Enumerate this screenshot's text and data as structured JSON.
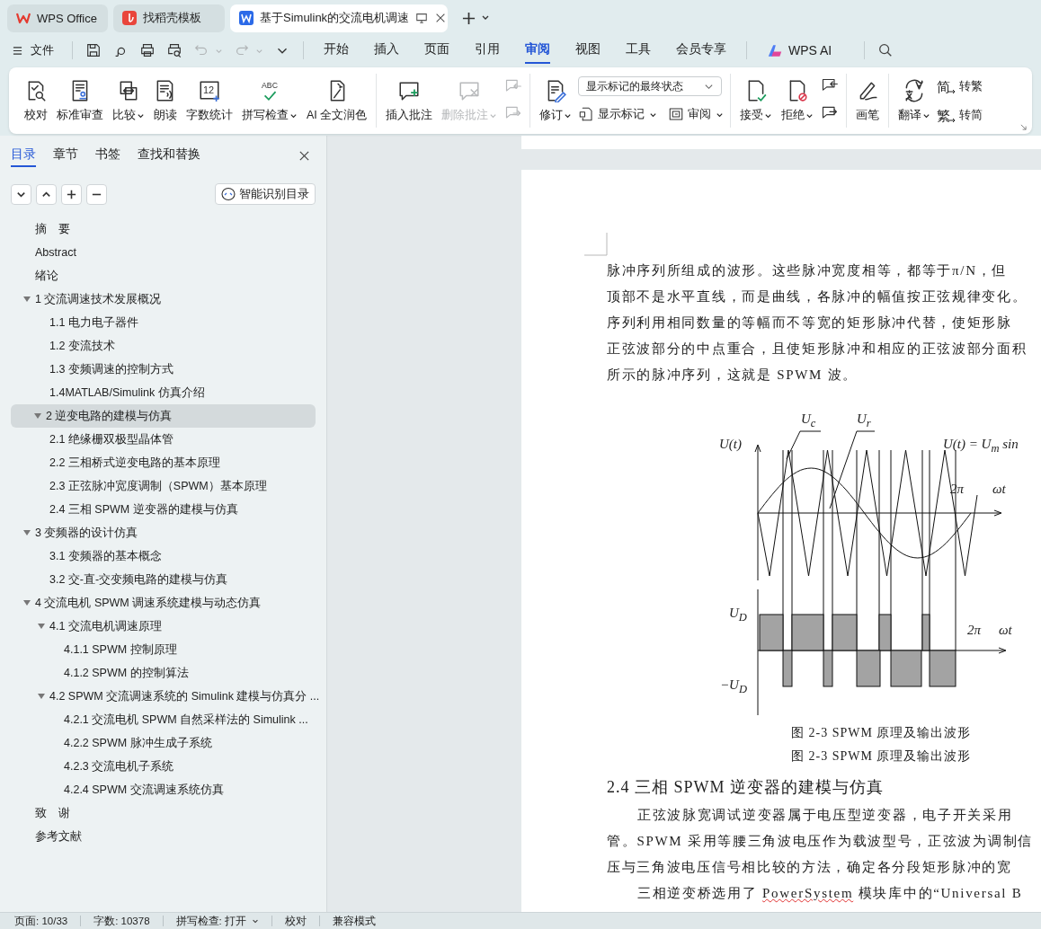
{
  "app_tabs": [
    {
      "label": "WPS Office",
      "selected": false,
      "kind": "home"
    },
    {
      "label": "找稻壳模板",
      "selected": false,
      "kind": "template"
    },
    {
      "label": "基于Simulink的交流电机调速",
      "selected": true,
      "kind": "document"
    }
  ],
  "menu": {
    "file": "文件",
    "tabs": [
      {
        "label": "开始",
        "selected": false
      },
      {
        "label": "插入",
        "selected": false
      },
      {
        "label": "页面",
        "selected": false
      },
      {
        "label": "引用",
        "selected": false
      },
      {
        "label": "审阅",
        "selected": true
      },
      {
        "label": "视图",
        "selected": false
      },
      {
        "label": "工具",
        "selected": false
      },
      {
        "label": "会员专享",
        "selected": false
      }
    ],
    "ai": "WPS AI"
  },
  "ribbon": {
    "groups": [
      {
        "items": [
          {
            "kind": "big",
            "label": "校对",
            "caret": false,
            "disabled": false
          },
          {
            "kind": "big",
            "label": "标准审查",
            "caret": false,
            "disabled": false
          },
          {
            "kind": "big",
            "label": "比较",
            "caret": true,
            "disabled": false
          },
          {
            "kind": "big",
            "label": "朗读",
            "caret": false,
            "disabled": false
          },
          {
            "kind": "big",
            "label": "字数统计",
            "caret": false,
            "disabled": false,
            "glyph": "12"
          },
          {
            "kind": "big",
            "label": "拼写检查",
            "caret": true,
            "disabled": false,
            "glyph": "ABC"
          },
          {
            "kind": "big",
            "label": "AI 全文润色",
            "caret": false,
            "disabled": false
          }
        ]
      },
      {
        "items": [
          {
            "kind": "big",
            "label": "插入批注",
            "caret": false,
            "disabled": false
          },
          {
            "kind": "big",
            "label": "删除批注",
            "caret": true,
            "disabled": true
          },
          {
            "kind": "column",
            "items": [
              {
                "kind": "icon",
                "disabled": true
              },
              {
                "kind": "icon",
                "disabled": true
              }
            ]
          }
        ]
      },
      {
        "items": [
          {
            "kind": "big",
            "label": "修订",
            "caret": true,
            "disabled": false
          },
          {
            "kind": "column",
            "items": [
              {
                "kind": "select",
                "value": "显示标记的最终状态"
              },
              {
                "kind": "row",
                "items": [
                  {
                    "kind": "small",
                    "label": "显示标记",
                    "caret": true,
                    "disabled": false
                  },
                  {
                    "kind": "small",
                    "label": "审阅",
                    "caret": true,
                    "disabled": false
                  }
                ]
              }
            ]
          }
        ]
      },
      {
        "items": [
          {
            "kind": "big",
            "label": "接受",
            "caret": true,
            "disabled": false
          },
          {
            "kind": "big",
            "label": "拒绝",
            "caret": true,
            "disabled": false
          },
          {
            "kind": "column",
            "items": [
              {
                "kind": "icon",
                "disabled": false
              },
              {
                "kind": "icon",
                "disabled": false
              }
            ]
          }
        ]
      },
      {
        "items": [
          {
            "kind": "big",
            "label": "画笔",
            "caret": false,
            "disabled": false
          }
        ]
      },
      {
        "items": [
          {
            "kind": "big",
            "label": "翻译",
            "caret": true,
            "disabled": false
          },
          {
            "kind": "column",
            "items": [
              {
                "kind": "small",
                "label": "转繁",
                "caret": false,
                "disabled": false,
                "glyph": "简"
              },
              {
                "kind": "small",
                "label": "转简",
                "caret": false,
                "disabled": false,
                "glyph": "繁"
              }
            ]
          }
        ]
      }
    ]
  },
  "nav_tabs": [
    {
      "label": "目录",
      "selected": true
    },
    {
      "label": "章节",
      "selected": false
    },
    {
      "label": "书签",
      "selected": false
    },
    {
      "label": "查找和替换",
      "selected": false
    }
  ],
  "smart_toc_button": "智能识别目录",
  "toc": {
    "items": [
      {
        "label": "摘　要",
        "selected": false
      },
      {
        "label": "Abstract",
        "selected": false
      },
      {
        "label": "绪论",
        "selected": false
      },
      {
        "label": "1 交流调速技术发展概况",
        "selected": false,
        "expanded": true,
        "children": [
          {
            "label": "1.1 电力电子器件",
            "selected": false
          },
          {
            "label": "1.2 变流技术",
            "selected": false
          },
          {
            "label": "1.3 变频调速的控制方式",
            "selected": false
          },
          {
            "label": "1.4MATLAB/Simulink 仿真介绍",
            "selected": false
          }
        ]
      },
      {
        "label": "2 逆变电路的建模与仿真",
        "selected": true,
        "expanded": true,
        "children": [
          {
            "label": "2.1 绝缘栅双极型晶体管",
            "selected": false
          },
          {
            "label": "2.2 三相桥式逆变电路的基本原理",
            "selected": false
          },
          {
            "label": "2.3 正弦脉冲宽度调制（SPWM）基本原理",
            "selected": false
          },
          {
            "label": "2.4 三相 SPWM 逆变器的建模与仿真",
            "selected": false
          }
        ]
      },
      {
        "label": "3 变频器的设计仿真",
        "selected": false,
        "expanded": true,
        "children": [
          {
            "label": "3.1 变频器的基本概念",
            "selected": false
          },
          {
            "label": "3.2 交-直-交变频电路的建模与仿真",
            "selected": false
          }
        ]
      },
      {
        "label": "4 交流电机 SPWM 调速系统建模与动态仿真",
        "selected": false,
        "expanded": true,
        "children": [
          {
            "label": "4.1  交流电机调速原理",
            "selected": false,
            "expanded": true,
            "children": [
              {
                "label": "4.1.1 SPWM 控制原理",
                "selected": false
              },
              {
                "label": "4.1.2 SPWM 的控制算法",
                "selected": false
              }
            ]
          },
          {
            "label": "4.2 SPWM 交流调速系统的 Simulink 建模与仿真分 ...",
            "selected": false,
            "expanded": true,
            "children": [
              {
                "label": "4.2.1 交流电机 SPWM 自然采样法的 Simulink ...",
                "selected": false
              },
              {
                "label": "4.2.2 SPWM 脉冲生成子系统",
                "selected": false
              },
              {
                "label": "4.2.3 交流电机子系统",
                "selected": false
              },
              {
                "label": "4.2.4 SPWM 交流调速系统仿真",
                "selected": false
              }
            ]
          }
        ]
      },
      {
        "label": "致　谢",
        "selected": false
      },
      {
        "label": "参考文献",
        "selected": false
      }
    ]
  },
  "document": {
    "paragraph_lines": [
      "脉冲序列所组成的波形。这些脉冲宽度相等，都等于π/N，但",
      "顶部不是水平直线，而是曲线，各脉冲的幅值按正弦规律变化。",
      "序列利用相同数量的等幅而不等宽的矩形脉冲代替，使矩形脉",
      "正弦波部分的中点重合，且使矩形脉冲和相应的正弦波部分面积",
      "所示的脉冲序列，这就是 SPWM 波。"
    ],
    "figure_labels": {
      "upper_y": "U(t)",
      "carrier": "U$_{c}$",
      "reference": "U$_{r}$",
      "formula": "U(t) = U$_{m}$ sin",
      "upper_period": "2π",
      "upper_x": "ωt",
      "high": "U$_{D}$",
      "low": "−U$_{D}$",
      "lower_period": "2π",
      "lower_x": "ωt"
    },
    "captions": [
      "图 2-3 SPWM 原理及输出波形",
      "图 2-3 SPWM 原理及输出波形"
    ],
    "heading": "2.4 三相 SPWM 逆变器的建模与仿真",
    "body_lines": [
      {
        "indent": true,
        "parts": [
          {
            "text": "正弦波脉宽调试逆变器属于电压型逆变器，电子开关采用",
            "misspelled": false
          }
        ]
      },
      {
        "indent": false,
        "parts": [
          {
            "text": "管。SPWM 采用等腰三角波电压作为载波型号，正弦波为调制信",
            "misspelled": false
          }
        ]
      },
      {
        "indent": false,
        "parts": [
          {
            "text": "压与三角波电压信号相比较的方法，确定各分段矩形脉冲的宽",
            "misspelled": false
          }
        ]
      },
      {
        "indent": true,
        "parts": [
          {
            "text": "三相逆变桥选用了 ",
            "misspelled": false
          },
          {
            "text": "PowerSystem",
            "misspelled": true
          },
          {
            "text": " 模块库中的“Universal B",
            "misspelled": false
          }
        ]
      }
    ]
  },
  "status_bar": [
    {
      "label": "页面: 10/33",
      "dropdown": false
    },
    {
      "label": "字数: 10378",
      "dropdown": false
    },
    {
      "label": "拼写检查: 打开",
      "dropdown": true
    },
    {
      "label": "校对",
      "dropdown": false
    },
    {
      "label": "兼容模式",
      "dropdown": false
    }
  ]
}
